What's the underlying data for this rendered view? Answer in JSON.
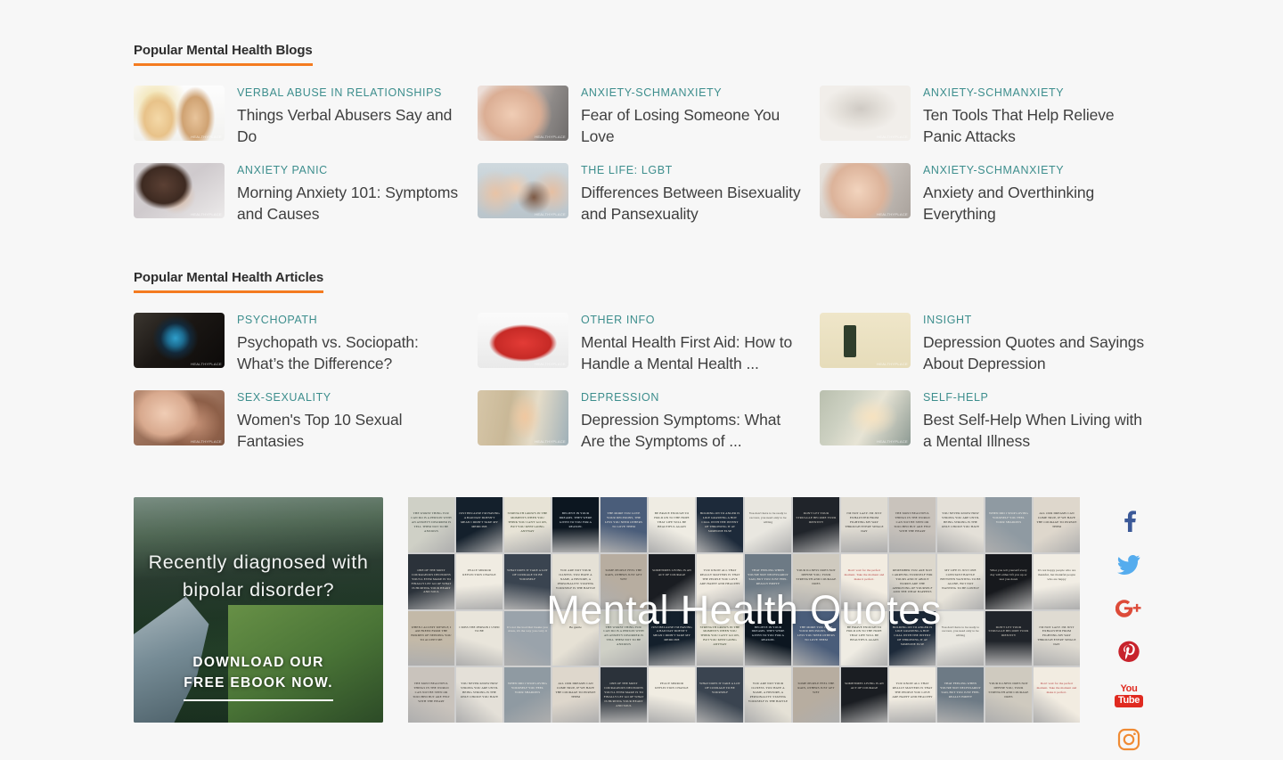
{
  "page": {
    "background_color": "#f7f7f7",
    "accent_color": "#f47b20",
    "category_color": "#3d8e8d",
    "title_color": "#3f3f3f"
  },
  "sections": [
    {
      "heading": "Popular Mental Health Blogs",
      "cards": [
        {
          "category": "VERBAL ABUSE IN RELATIONSHIPS",
          "title": "Things Verbal Abusers Say and Do",
          "thumb": "couple-arguing-image",
          "thumb_class": "t-couple",
          "watermark": "HEALTHYPLACE"
        },
        {
          "category": "ANXIETY-SCHMANXIETY",
          "title": "Fear of Losing Someone You Love",
          "thumb": "woman-covering-face-image",
          "thumb_class": "t-woman",
          "watermark": "HEALTHYPLACE"
        },
        {
          "category": "ANXIETY-SCHMANXIETY",
          "title": "Ten Tools That Help Relieve Panic Attacks",
          "thumb": "zen-garden-butterfly-image",
          "thumb_class": "t-zen",
          "watermark": "HEALTHYPLACE"
        },
        {
          "category": "ANXIETY PANIC",
          "title": "Morning Anxiety 101: Symptoms and Causes",
          "thumb": "man-lying-in-bed-image",
          "thumb_class": "t-sleep",
          "watermark": "HEALTHYPLACE"
        },
        {
          "category": "THE LIFE: LGBT",
          "title": "Differences Between Bisexuality and Pansexuality",
          "thumb": "group-of-friends-image",
          "thumb_class": "t-friends",
          "watermark": "HEALTHYPLACE"
        },
        {
          "category": "ANXIETY-SCHMANXIETY",
          "title": "Anxiety and Overthinking Everything",
          "thumb": "woman-biting-nails-image",
          "thumb_class": "t-bite",
          "watermark": "HEALTHYPLACE"
        }
      ]
    },
    {
      "heading": "Popular Mental Health Articles",
      "cards": [
        {
          "category": "PSYCHOPATH",
          "title": "Psychopath vs. Sociopath: What’s the Difference?",
          "thumb": "dark-eye-image",
          "thumb_class": "t-eye",
          "watermark": "HEALTHYPLACE"
        },
        {
          "category": "OTHER INFO",
          "title": "Mental Health First Aid: How to Handle a Mental Health  ...",
          "thumb": "first-aid-kit-image",
          "thumb_class": "t-firstaid",
          "watermark": "HEALTHYPLACE"
        },
        {
          "category": "INSIGHT",
          "title": "Depression Quotes and Sayings About Depression",
          "thumb": "depression-quotes-illustration-image",
          "thumb_class": "t-depquote",
          "watermark": "HEALTHYPLACE"
        },
        {
          "category": "SEX-SEXUALITY",
          "title": "Women's Top 10 Sexual Fantasies",
          "thumb": "intimate-couple-image",
          "thumb_class": "t-intimate",
          "watermark": "HEALTHYPLACE"
        },
        {
          "category": "DEPRESSION",
          "title": "Depression Symptoms: What Are the Symptoms of ...",
          "thumb": "woman-by-window-image",
          "thumb_class": "t-window",
          "watermark": "HEALTHYPLACE"
        },
        {
          "category": "SELF-HELP",
          "title": "Best Self-Help When Living with a Mental Illness",
          "thumb": "hands-with-coffee-image",
          "thumb_class": "t-coffee",
          "watermark": "HEALTHYPLACE"
        }
      ]
    }
  ],
  "ad": {
    "headline": "Recently  diagnosed  with bipolar  disorder?",
    "cta_line1": "DOWNLOAD  OUR",
    "cta_line2": "FREE  EBOOK  NOW.",
    "image": "forest-river-landscape-image"
  },
  "collage": {
    "title": "Mental Health Quotes",
    "image": "mental-health-quotes-pinterest-collage-image",
    "tiles": [
      "THE WORST THING YOU CAN DO IS A PERSON WITH AN ANXIETY DISORDER IS TELL THEM NOT TO BE ANXIOUS",
      "JUST BECAUSE I'M HAVING A BAD DAY DOESN'T MEAN I DIDN'T TAKE MY MEDICINE",
      "STRENGTH GROWS IN THE MOMENTS WHEN YOU THINK YOU CAN'T GO ON, BUT YOU KEEP GOING ANYWAY",
      "BELIEVE IN YOUR DREAMS. THEY WERE GIVEN TO YOU FOR A REASON.",
      "THE MORE YOU LOVE YOUR DECISIONS, THE LESS YOU NEED OTHERS TO LOVE THEM",
      "BE BRAVE ENOUGH TO HOLD ON TO THE HOPE THAT LIFE WILL BE BEAUTIFUL AGAIN",
      "HOLDING ON TO ANGER IS LIKE GRASPING A HOT COAL WITH THE INTENT OF THROWING IT AT SOMEONE ELSE",
      "You don't have to be ready to recover, you need only to be willing",
      "DON'T LET YOUR STRUGGLE BECOME YOUR IDENTITY",
      "I'M NOT LAZY. I'M JUST EXHAUSTED FROM FIGHTING MY WAY THROUGH EVERY SINGLE DAY",
      "THE MOST BEAUTIFUL THINGS IN THE WORLD CAN NOT BE SEEN OR TOUCHED BUT ARE FELT WITH THE HEART",
      "YOU NEVER KNOW HOW STRONG YOU ARE UNTIL BEING STRONG IS THE ONLY CHOICE YOU HAVE",
      "WHEN DID I STOP LOVING YOURSELF YOU FEEL YOUR SHADOWS",
      "ALL OUR DREAMS CAN COME TRUE, IF WE HAVE THE COURAGE TO PURSUE THEM",
      "ONE OF THE MOST COURAGEOUS DECISIONS YOU'LL EVER MAKE IS TO FINALLY LET GO OF WHAT IS HURTING YOUR HEART AND SOUL",
      "PEACE MIRROR REFLECTION CHANGE",
      "WHAT DOES IT TAKE A LOT OF COURAGE TO BE YOURSELF",
      "YOU ARE NOT YOUR ILLNESS. YOU HAVE A NAME, A HISTORY, A PERSONALITY. STAYING YOURSELF IS THE BATTLE",
      "SOME PEOPLE FEEL THE RAIN, OTHERS JUST GET WET",
      "SOMETIMES LIVING IS AN ACT OF COURAGE",
      "YOU KNOW ALL THAT REALLY MATTERS IS THAT THE PEOPLE YOU LOVE ARE HAPPY AND HEALTHY",
      "THAT FEELING WHEN YOU'RE NOT NECESSARILY SAD, BUT YOU JUST FEEL REALLY EMPTY",
      "YOUR ILLNESS DOES NOT DEFINE YOU, YOUR STRENGTH AND COURAGE DOES",
      "Don't wait for the perfect moment. Take the moment and make it perfect.",
      "REMEMBER YOU ARE NOT CARRYING YOURSELF FOR YOURS AND IT ABOUT WORDS ARE THE APPROVING OF YOURSELF AND THE WHAT HAPPENS",
      "MY LIFE IS JUST ONE CONSTANT BATTLE BETWEEN WANTING TO BE ALONE, BUT NOT WANTING TO BE LONELY",
      "What you tell yourself every day will either lift you up or tear you down",
      "It's not happy people who are thankful, but thankful people who are happy",
      "WHEN I ACCEPT MYSELF, I AM FREED FROM THE BURDEN OF NEEDING YOU TO ACCEPT ME",
      "I MISS THE PERSON I USED TO BE",
      "It's not the load that breaks you down, it's the way you carry it",
      "Be gentle"
    ]
  },
  "social": {
    "links": [
      {
        "name": "facebook",
        "label": "f",
        "color": "#3b5998"
      },
      {
        "name": "twitter",
        "label": "Twitter",
        "color": "#55acee"
      },
      {
        "name": "google-plus",
        "label": "G+",
        "color": "#dd4b39"
      },
      {
        "name": "pinterest",
        "label": "Pinterest",
        "color": "#c8232c"
      },
      {
        "name": "youtube",
        "label_top": "You",
        "label_bottom": "Tube",
        "color": "#e02a20"
      },
      {
        "name": "instagram",
        "label": "Instagram",
        "color": "#f08b34"
      }
    ]
  }
}
